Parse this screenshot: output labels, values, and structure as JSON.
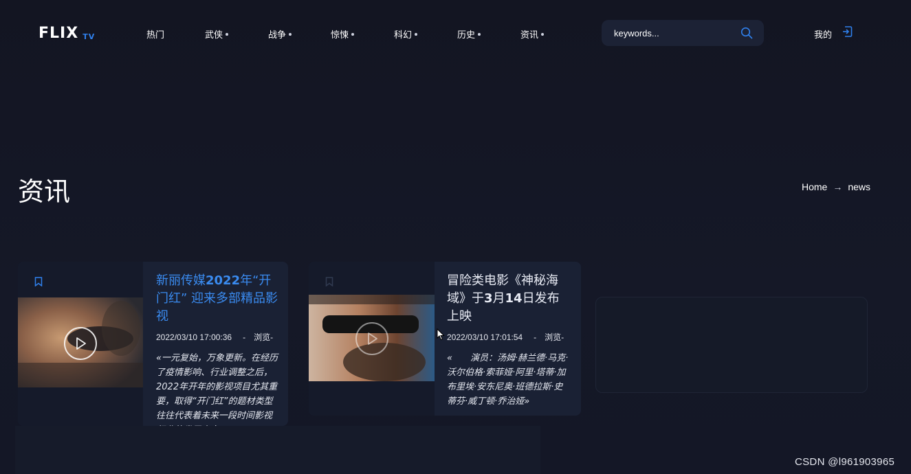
{
  "header": {
    "logo": "FLIX",
    "logo_sub": "TV",
    "nav": [
      {
        "label": "热门",
        "dot": false
      },
      {
        "label": "武侠",
        "dot": true
      },
      {
        "label": "战争",
        "dot": true
      },
      {
        "label": "惊悚",
        "dot": true
      },
      {
        "label": "科幻",
        "dot": true
      },
      {
        "label": "历史",
        "dot": true
      },
      {
        "label": "资讯",
        "dot": true
      }
    ],
    "search_placeholder": "keywords...",
    "user_label": "我的"
  },
  "page": {
    "title": "资讯",
    "breadcrumb_home": "Home",
    "breadcrumb_arrow": "→",
    "breadcrumb_current": "news"
  },
  "cards": [
    {
      "title_prefix": "新丽传媒",
      "title_bold": "2022",
      "title_suffix": "年“开门红” 迎来多部精品影视",
      "date": "2022/03/10 17:00:36",
      "sep": "-",
      "views": "浏览-",
      "desc": "«一元复始，万象更新。在经历了疫情影响、行业调整之后，2022年开年的影视项目尤其重要，取得“开门红”的题材类型往往代表着未来一段时间影视行业的发展方向。»"
    },
    {
      "title_prefix": "冒险类电影《神秘海域》于",
      "title_bold": "3",
      "title_mid": "月",
      "title_bold2": "14",
      "title_suffix": "日发布上映",
      "date": "2022/03/10 17:01:54",
      "sep": "-",
      "views": "浏览-",
      "desc": "«　　演员：汤姆·赫兰德·马克·沃尔伯格·索菲娅·阿里·塔蒂·加布里埃·安东尼奥·班德拉斯·史蒂芬·威丁顿·乔治娅»"
    }
  ],
  "watermark": "CSDN @l961903965",
  "colors": {
    "accent": "#2f80ed",
    "title_blue": "#3a8bf0",
    "background": "#141622",
    "card": "#1a2134"
  }
}
